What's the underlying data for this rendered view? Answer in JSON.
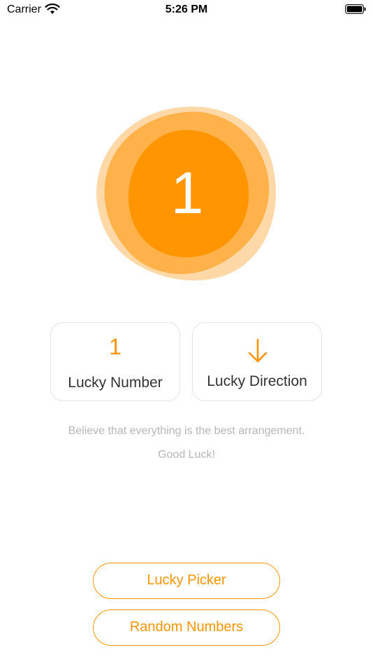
{
  "status_bar": {
    "carrier": "Carrier",
    "time": "5:26 PM",
    "icons": [
      "wifi-icon",
      "battery-icon"
    ]
  },
  "hero": {
    "number": "1",
    "blob_colors": [
      "#ffd8a8",
      "#ffb14a",
      "#ff9500"
    ]
  },
  "cards": {
    "lucky_number": {
      "value": "1",
      "label": "Lucky Number"
    },
    "lucky_direction": {
      "icon": "arrow-down-icon",
      "label": "Lucky Direction"
    }
  },
  "message": {
    "line1": "Believe that everything is the best arrangement.",
    "line2": "Good Luck!"
  },
  "buttons": {
    "lucky_picker": "Lucky Picker",
    "random_numbers": "Random Numbers"
  },
  "colors": {
    "accent": "#ff9500",
    "muted_text": "#b6b6b6",
    "card_border": "#e4e4e4"
  }
}
